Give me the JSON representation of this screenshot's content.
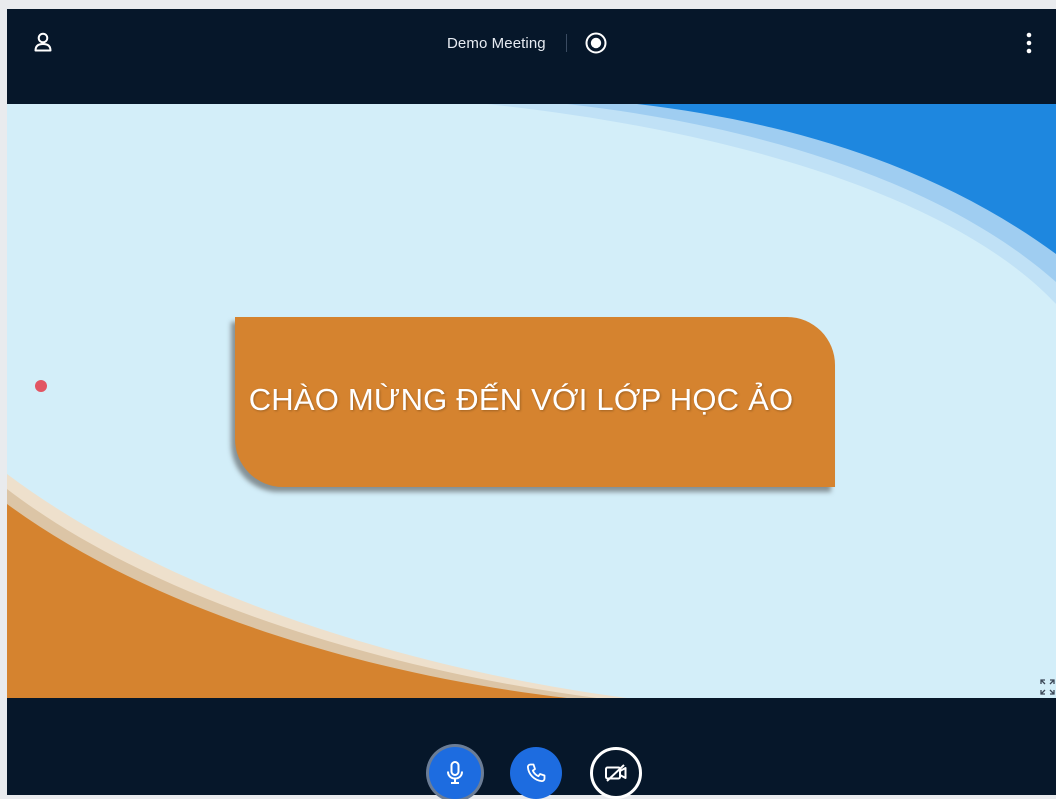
{
  "meeting": {
    "title": "Demo Meeting"
  },
  "icons": {
    "user": "user-icon",
    "record": "record-icon",
    "more": "more-vertical-icon",
    "fullscreen": "fullscreen-icon",
    "microphone": "microphone-icon",
    "phone": "phone-icon",
    "camera_off": "video-off-icon"
  },
  "slide": {
    "banner_text": "CHÀO MỪNG ĐẾN VỚI LỚP HỌC ẢO"
  },
  "colors": {
    "bar_background": "#06172a",
    "slide_background": "#d3eef9",
    "banner": "#d5832f",
    "accent_blue": "#1d6ce0",
    "cursor_dot": "#e25563"
  }
}
